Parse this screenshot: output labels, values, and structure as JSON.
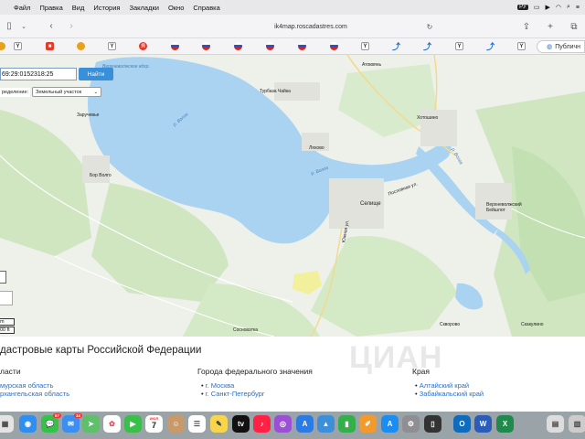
{
  "menubar": {
    "items": [
      "Файл",
      "Правка",
      "Вид",
      "История",
      "Закладки",
      "Окно",
      "Справка"
    ],
    "input_badge": "РУ"
  },
  "toolbar": {
    "url": "ik4map.roscadastres.com"
  },
  "favorites": {
    "public_label": "Публичн"
  },
  "map": {
    "search_value": "69:29:0152318:25",
    "find_button": "Найти",
    "detect_label": "ределение:",
    "detect_select": "Земельный участок",
    "scale_top": "m",
    "scale_bottom": "00 ft",
    "labels": {
      "reservoir": "Верхневолжское вдхр.",
      "zaruchevye": "Заручевье",
      "bor_volgo": "Бор Волго",
      "turbaza": "Турбаза Чайка",
      "lyahovo": "Ляхово",
      "atok": "Атоквянь",
      "khotoshino": "Хотошино",
      "selishche": "Селище",
      "podpolnaya": "Пословная ул.",
      "yuzhnaya": "Южная ул.",
      "volga1": "р. Волга",
      "volga2": "р. Волга",
      "volga3": "р. Волга",
      "beyshlot": "Верхневолжский Бейшлот",
      "sosnovatka": "Сосноватка",
      "skvorovo": "Скворово",
      "skakulino": "Скакулино"
    }
  },
  "content": {
    "title": "дастровые карты Российской Федерации",
    "col1_head": "ласти",
    "col1_links": [
      "мурская область",
      "рхангельская область"
    ],
    "col2_head": "Города федерального значения",
    "col2_links": [
      "г. Москва",
      "г. Санкт-Петербург"
    ],
    "col3_head": "Края",
    "col3_links": [
      "Алтайский край",
      "Забайкальский край"
    ],
    "watermark": "ЦИАН"
  },
  "dock": {
    "calendar_month": "ИЮЛ",
    "calendar_day": "7",
    "mail_badge": "34",
    "messages_badge": "57"
  },
  "colors": {
    "water": "#aad3f2",
    "forest": "#cfe6c1",
    "land": "#eef0ea",
    "link": "#2a6fc9",
    "accent": "#3a8fd9"
  }
}
